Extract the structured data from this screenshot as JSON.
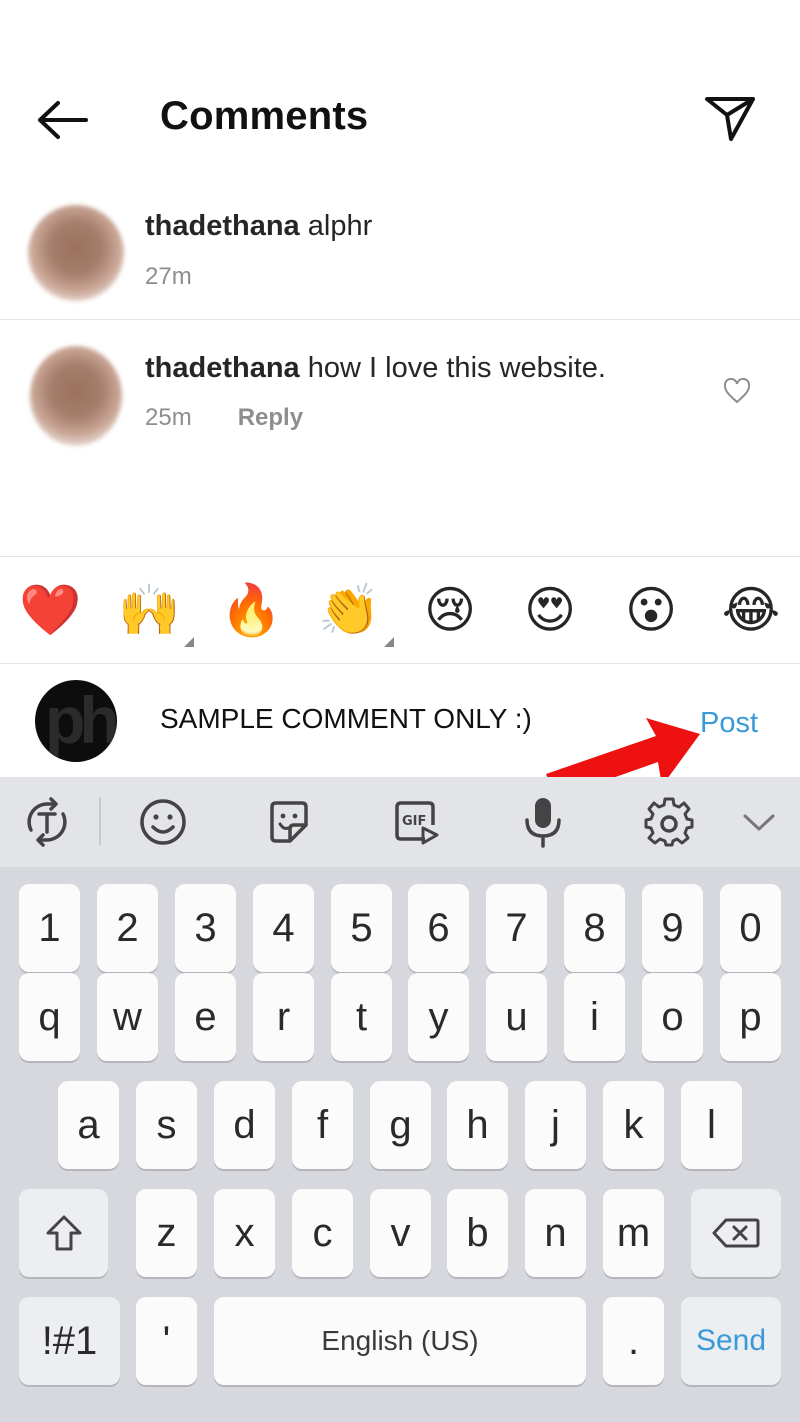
{
  "header": {
    "title": "Comments",
    "back_icon": "arrow-left-icon",
    "send_icon": "paper-plane-icon"
  },
  "comments": [
    {
      "username": "thadethana",
      "text": "alphr",
      "time": "27m",
      "reply": ""
    },
    {
      "username": "thadethana",
      "text": "how I love this website.",
      "time": "25m",
      "reply": "Reply"
    }
  ],
  "emoji_bar": [
    "❤️",
    "🙌",
    "🔥",
    "👏",
    "😢",
    "😍",
    "😮",
    "😂"
  ],
  "composer": {
    "value": "SAMPLE COMMENT ONLY :)",
    "post_label": "Post",
    "avatar_text": "ph"
  },
  "keyboard": {
    "row_numbers": [
      "1",
      "2",
      "3",
      "4",
      "5",
      "6",
      "7",
      "8",
      "9",
      "0"
    ],
    "row_top": [
      "q",
      "w",
      "e",
      "r",
      "t",
      "y",
      "u",
      "i",
      "o",
      "p"
    ],
    "row_middle": [
      "a",
      "s",
      "d",
      "f",
      "g",
      "h",
      "j",
      "k",
      "l"
    ],
    "row_bottom": [
      "z",
      "x",
      "c",
      "v",
      "b",
      "n",
      "m"
    ],
    "symbols_label": "!#1",
    "apostrophe_label": "'",
    "space_label": "English (US)",
    "period_label": ".",
    "send_label": "Send"
  },
  "colors": {
    "accent": "#3a9ad9",
    "annotation_arrow": "#ee1111"
  }
}
